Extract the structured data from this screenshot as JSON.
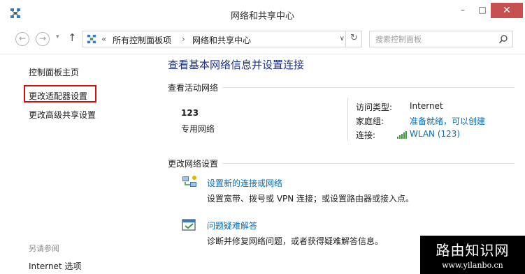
{
  "window": {
    "title": "网络和共享中心",
    "controls": {
      "minimize": "–",
      "maximize": "□",
      "close": "✕"
    }
  },
  "addressbar": {
    "back_icon": "arrow-left-icon",
    "forward_icon": "arrow-right-icon",
    "up_icon": "arrow-up-icon",
    "path_prefix": "«",
    "path": [
      "所有控制面板项",
      "网络和共享中心"
    ],
    "path_separator": "›",
    "search_placeholder": "搜索控制面板"
  },
  "left_panel": {
    "links": [
      "控制面板主页",
      "更改适配器设置",
      "更改高级共享设置"
    ],
    "highlighted_index": 1,
    "highlight_color": "#d01010",
    "see_also_title": "另请参阅",
    "see_also_links": [
      "Internet 选项"
    ]
  },
  "main": {
    "title": "查看基本网络信息并设置连接",
    "active_section": "查看活动网络",
    "network": {
      "name": "123",
      "type": "专用网络",
      "access_type_label": "访问类型:",
      "access_type_value": "Internet",
      "homegroup_label": "家庭组:",
      "homegroup_value": "准备就绪，可以创建",
      "connection_label": "连接:",
      "connection_value": "WLAN (123)"
    },
    "change_section": "更改网络设置",
    "tasks": [
      {
        "icon": "network-setup-icon",
        "link": "设置新的连接或网络",
        "desc": "设置宽带、拨号或 VPN 连接；或设置路由器或接入点。"
      },
      {
        "icon": "troubleshoot-icon",
        "link": "问题疑难解答",
        "desc": "诊断并修复网络问题，或者获得疑难解答信息。"
      }
    ]
  },
  "watermark": {
    "title": "路由知识网",
    "url": "www.yilanbo.cn"
  },
  "colors": {
    "title_blue": "#1e3287",
    "link_blue": "#0a6fb7",
    "close_red": "#c75050"
  }
}
